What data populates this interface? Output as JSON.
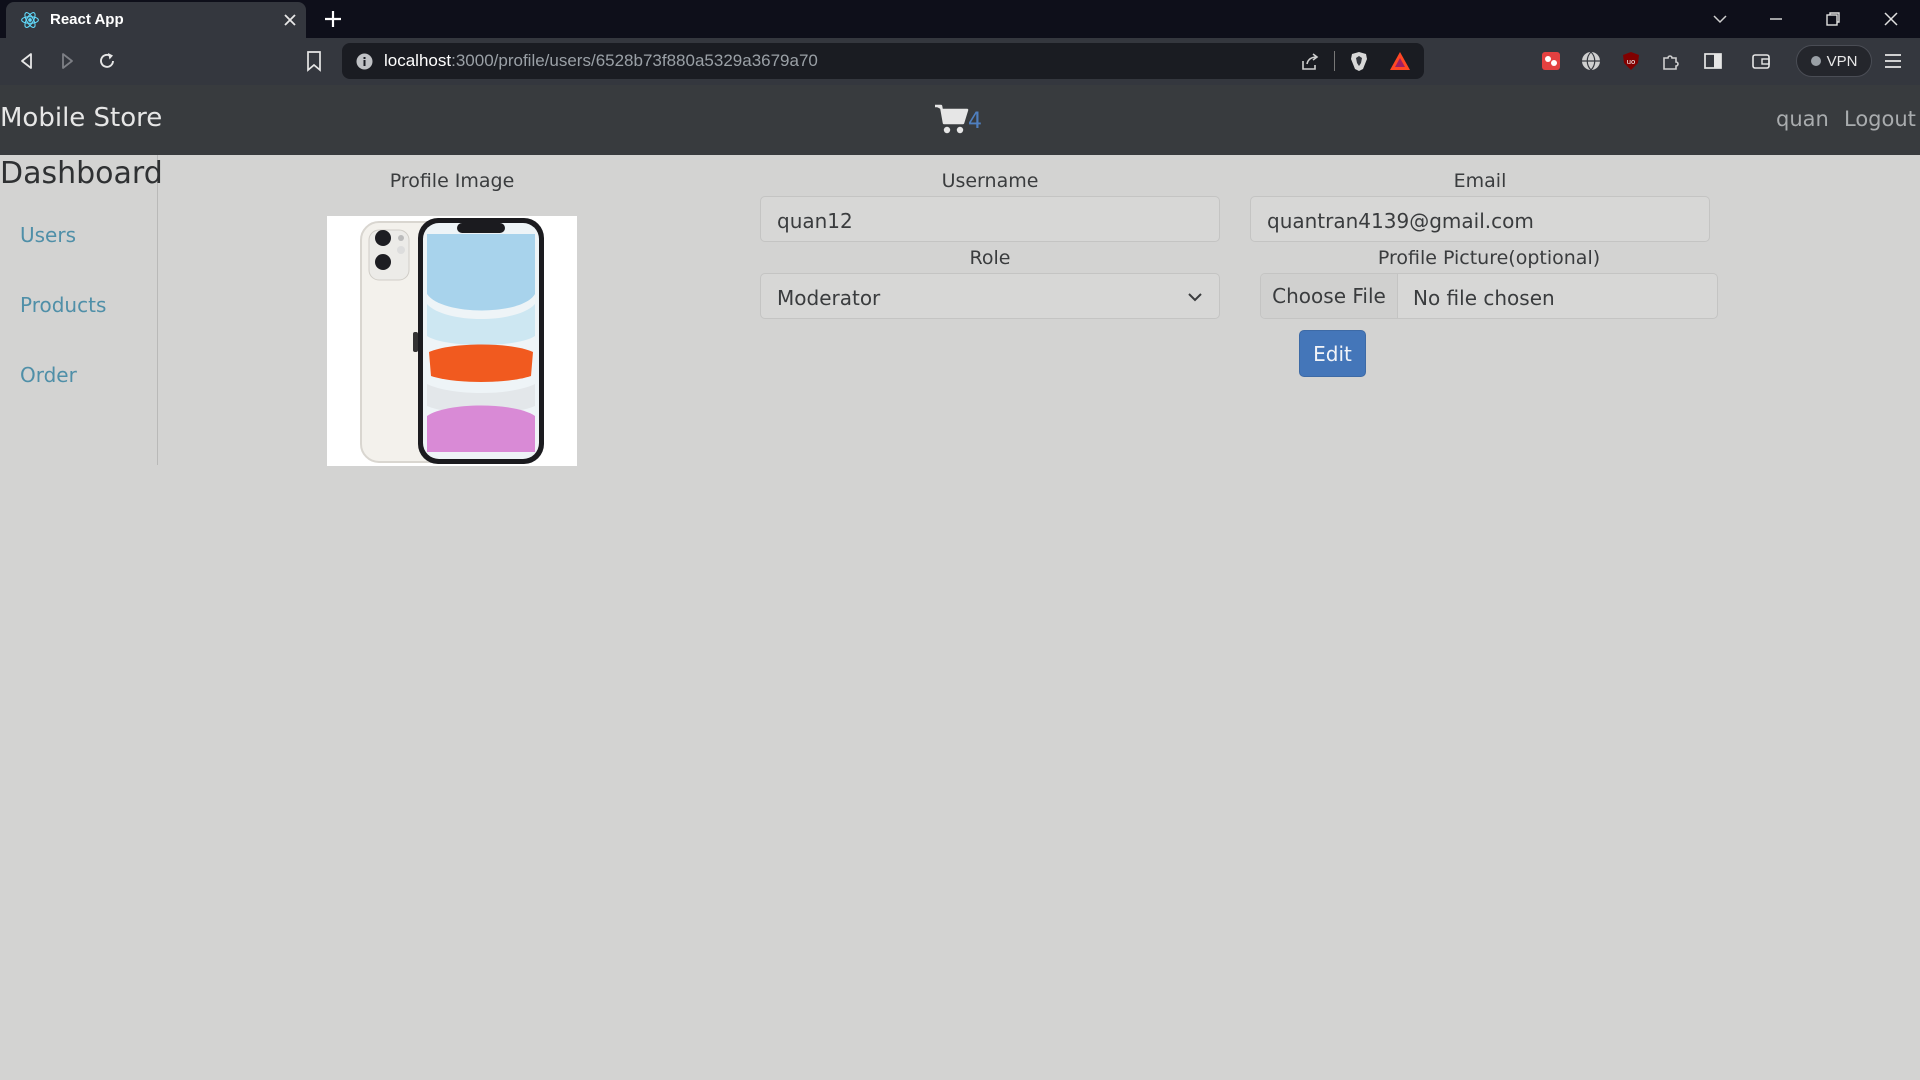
{
  "browser": {
    "tab_title": "React App",
    "url_host": "localhost",
    "url_rest": ":3000/profile/users/6528b73f880a5329a3679a70",
    "vpn_label": "VPN"
  },
  "navbar": {
    "brand": "Mobile Store",
    "cart_count": "4",
    "user": "quan",
    "logout": "Logout"
  },
  "sidebar": {
    "title": "Dashboard",
    "items": [
      {
        "label": "Users"
      },
      {
        "label": "Products"
      },
      {
        "label": "Order"
      }
    ]
  },
  "form": {
    "profile_image_label": "Profile Image",
    "username_label": "Username",
    "username_value": "quan12",
    "email_label": "Email",
    "email_value": "quantran4139@gmail.com",
    "role_label": "Role",
    "role_value": "Moderator",
    "picture_label": "Profile Picture(optional)",
    "choose_file": "Choose File",
    "file_status": "No file chosen",
    "edit": "Edit"
  },
  "colors": {
    "page_bg": "#d3d3d2",
    "navbar_bg": "#383b3e",
    "link": "#4f8fa8",
    "primary_button": "#4476b9"
  }
}
